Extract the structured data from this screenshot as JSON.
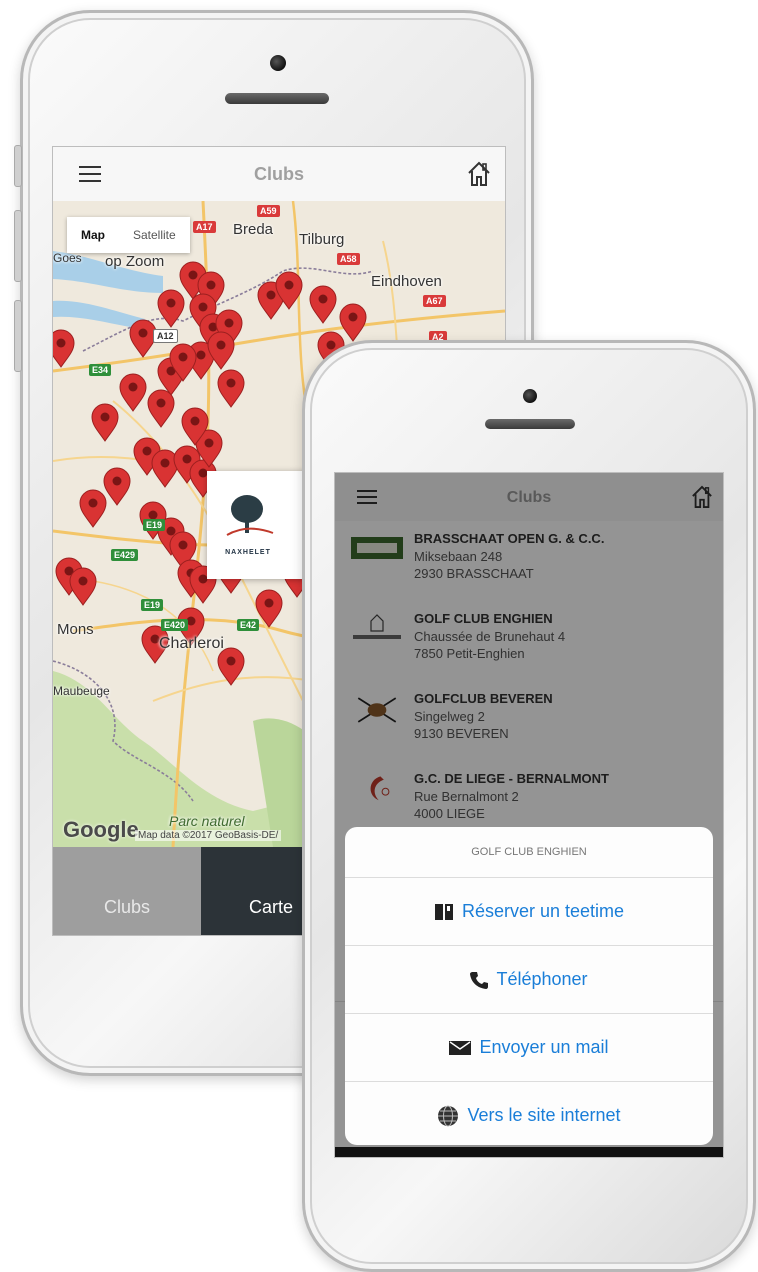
{
  "phone_left": {
    "header": {
      "title": "Clubs"
    },
    "map": {
      "toggle": {
        "map_label": "Map",
        "satellite_label": "Satellite"
      },
      "cities": [
        "Breda",
        "Tilburg",
        "Goes",
        "op Zoom",
        "Eindhoven",
        "Mons",
        "Charleroi",
        "Maubeuge",
        "Parc naturel",
        "Mons"
      ],
      "roads": [
        "A59",
        "A17",
        "A58",
        "A67",
        "A2",
        "A12",
        "E34",
        "E19",
        "E429",
        "E19",
        "E420",
        "E42"
      ],
      "google_logo": "Google",
      "credit": "Map data ©2017 GeoBasis-DE/",
      "popup_brand": "NAXHELET"
    },
    "tabs": {
      "clubs": "Clubs",
      "carte": "Carte"
    },
    "colors": {
      "pin": "#d93333",
      "tab_active": "#2c3338",
      "tab_inactive": "#9e9e9e"
    }
  },
  "phone_right": {
    "header": {
      "title": "Clubs"
    },
    "clubs": [
      {
        "name": "BRASSCHAAT OPEN G. & C.C.",
        "street": "Miksebaan 248",
        "city": "2930 BRASSCHAAT",
        "logo": "brasschaat-logo"
      },
      {
        "name": "GOLF CLUB ENGHIEN",
        "street": "Chaussée de Brunehaut 4",
        "city": "7850 Petit-Enghien",
        "logo": "enghien-logo"
      },
      {
        "name": "GOLFCLUB BEVEREN",
        "street": "Singelweg 2",
        "city": "9130 BEVEREN",
        "logo": "beveren-logo"
      },
      {
        "name": "G.C. DE LIEGE - BERNALMONT",
        "street": "Rue Bernalmont 2",
        "city": "4000 LIEGE",
        "logo": "liege-logo"
      }
    ],
    "action_sheet": {
      "title": "GOLF CLUB ENGHIEN",
      "actions": [
        {
          "label": "Réserver un teetime",
          "icon": "book-icon"
        },
        {
          "label": "Téléphoner",
          "icon": "phone-icon"
        },
        {
          "label": "Envoyer un mail",
          "icon": "mail-icon"
        },
        {
          "label": "Vers le site internet",
          "icon": "globe-icon"
        }
      ]
    },
    "colors": {
      "action_text": "#1a7ed8"
    }
  }
}
